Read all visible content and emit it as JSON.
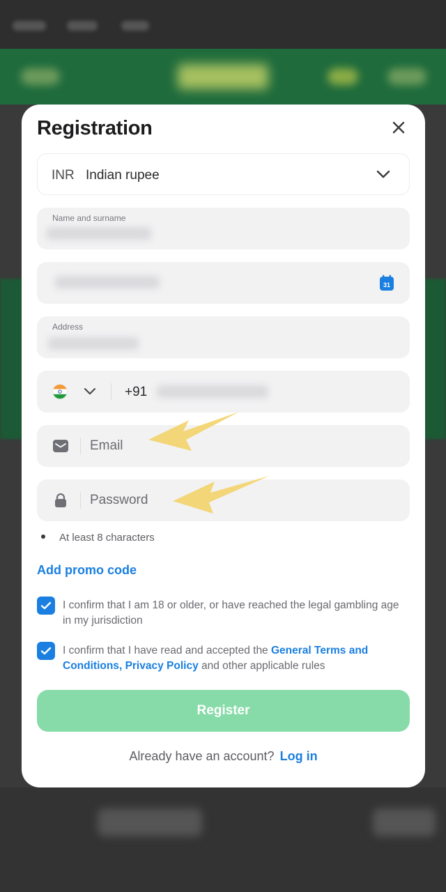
{
  "modal": {
    "title": "Registration"
  },
  "currency": {
    "code": "INR",
    "name": "Indian rupee"
  },
  "fields": {
    "name_label": "Name and surname",
    "address_label": "Address",
    "phone_code": "+91",
    "email_placeholder": "Email",
    "password_placeholder": "Password",
    "password_hint": "At least 8 characters"
  },
  "promo": {
    "label": "Add promo code"
  },
  "consents": {
    "age_text": "I confirm that I am 18 or older, or have reached the legal gambling age in my jurisdiction",
    "terms_prefix": "I confirm that I have read and accepted the ",
    "terms_link": "General Terms and Conditions",
    "terms_sep": ", ",
    "privacy_link": "Privacy Policy",
    "terms_suffix": " and other applicable rules"
  },
  "actions": {
    "register_label": "Register",
    "have_account": "Already have an account?",
    "login_label": "Log in"
  },
  "icons": {
    "close": "close-icon",
    "chevron": "chevron-down-icon",
    "calendar": "calendar-icon",
    "calendar_day": "31",
    "flag": "india-flag-icon",
    "email": "mail-icon",
    "password": "lock-icon",
    "check": "check-icon"
  },
  "colors": {
    "accent": "#1a7fe0",
    "register_bg": "#86dba8",
    "annotation_arrow": "#f3d36a"
  }
}
